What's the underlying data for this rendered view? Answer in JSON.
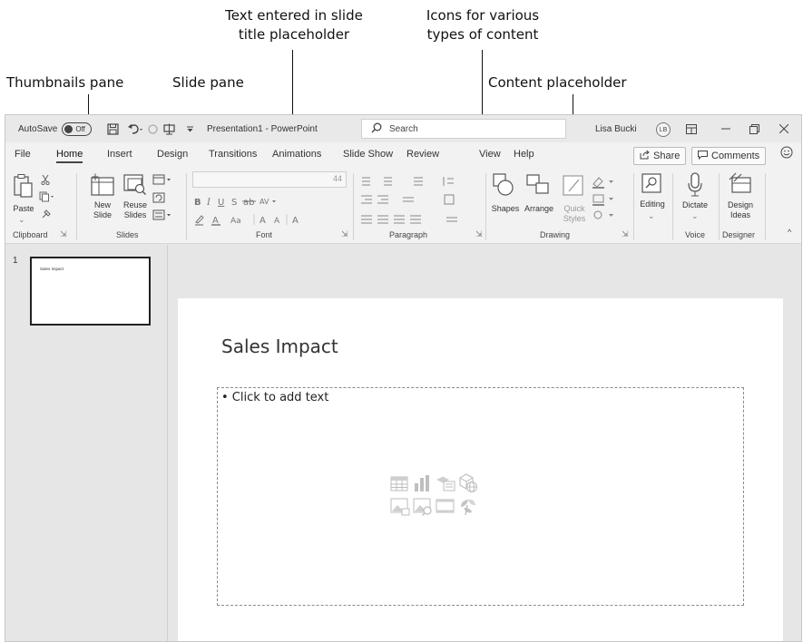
{
  "callouts": {
    "title_text": "Text entered in slide title placeholder",
    "title_line1": "Text entered in slide",
    "title_line2": "title placeholder",
    "icons_line1": "Icons for various",
    "icons_line2": "types of content",
    "thumbnails": "Thumbnails pane",
    "slide_pane": "Slide pane",
    "content_placeholder": "Content placeholder"
  },
  "titlebar": {
    "autosave": "AutoSave",
    "toggle": "Off",
    "doc_title": "Presentation1 - PowerPoint",
    "search": "Search",
    "user": "Lisa Bucki",
    "initials": "LB"
  },
  "tabs": [
    "File",
    "Home",
    "Insert",
    "Design",
    "Transitions",
    "Animations",
    "Slide Show",
    "Review",
    "View",
    "Help"
  ],
  "active_tab": "Home",
  "share": "Share",
  "comments": "Comments",
  "ribbon": {
    "paste": "Paste",
    "new_slide_1": "New",
    "new_slide_2": "Slide",
    "reuse_1": "Reuse",
    "reuse_2": "Slides",
    "font_size": "44",
    "shapes": "Shapes",
    "arrange": "Arrange",
    "quick_1": "Quick",
    "quick_2": "Styles",
    "editing": "Editing",
    "dictate": "Dictate",
    "design_1": "Design",
    "design_2": "Ideas",
    "groups": {
      "clipboard": "Clipboard",
      "slides": "Slides",
      "font": "Font",
      "paragraph": "Paragraph",
      "drawing": "Drawing",
      "voice": "Voice",
      "designer": "Designer"
    }
  },
  "slide": {
    "number": "1",
    "thumb_title": "Sales Impact",
    "title": "Sales Impact",
    "content": "• Click to add text"
  },
  "content_icons": [
    "table-icon",
    "chart-icon",
    "smartart-icon",
    "3d-model-icon",
    "picture-icon",
    "online-picture-icon",
    "video-icon",
    "icons-icon"
  ]
}
